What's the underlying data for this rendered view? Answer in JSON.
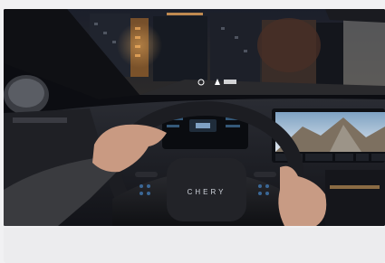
{
  "photo": {
    "subject": "car-interior-night-city",
    "brand_mark": "CHERY",
    "hud_text": "0",
    "hud_icon": "navigation-arrow-icon"
  },
  "colors": {
    "page_bg": "#f1f1f3",
    "caption_bg": "#ececee"
  }
}
